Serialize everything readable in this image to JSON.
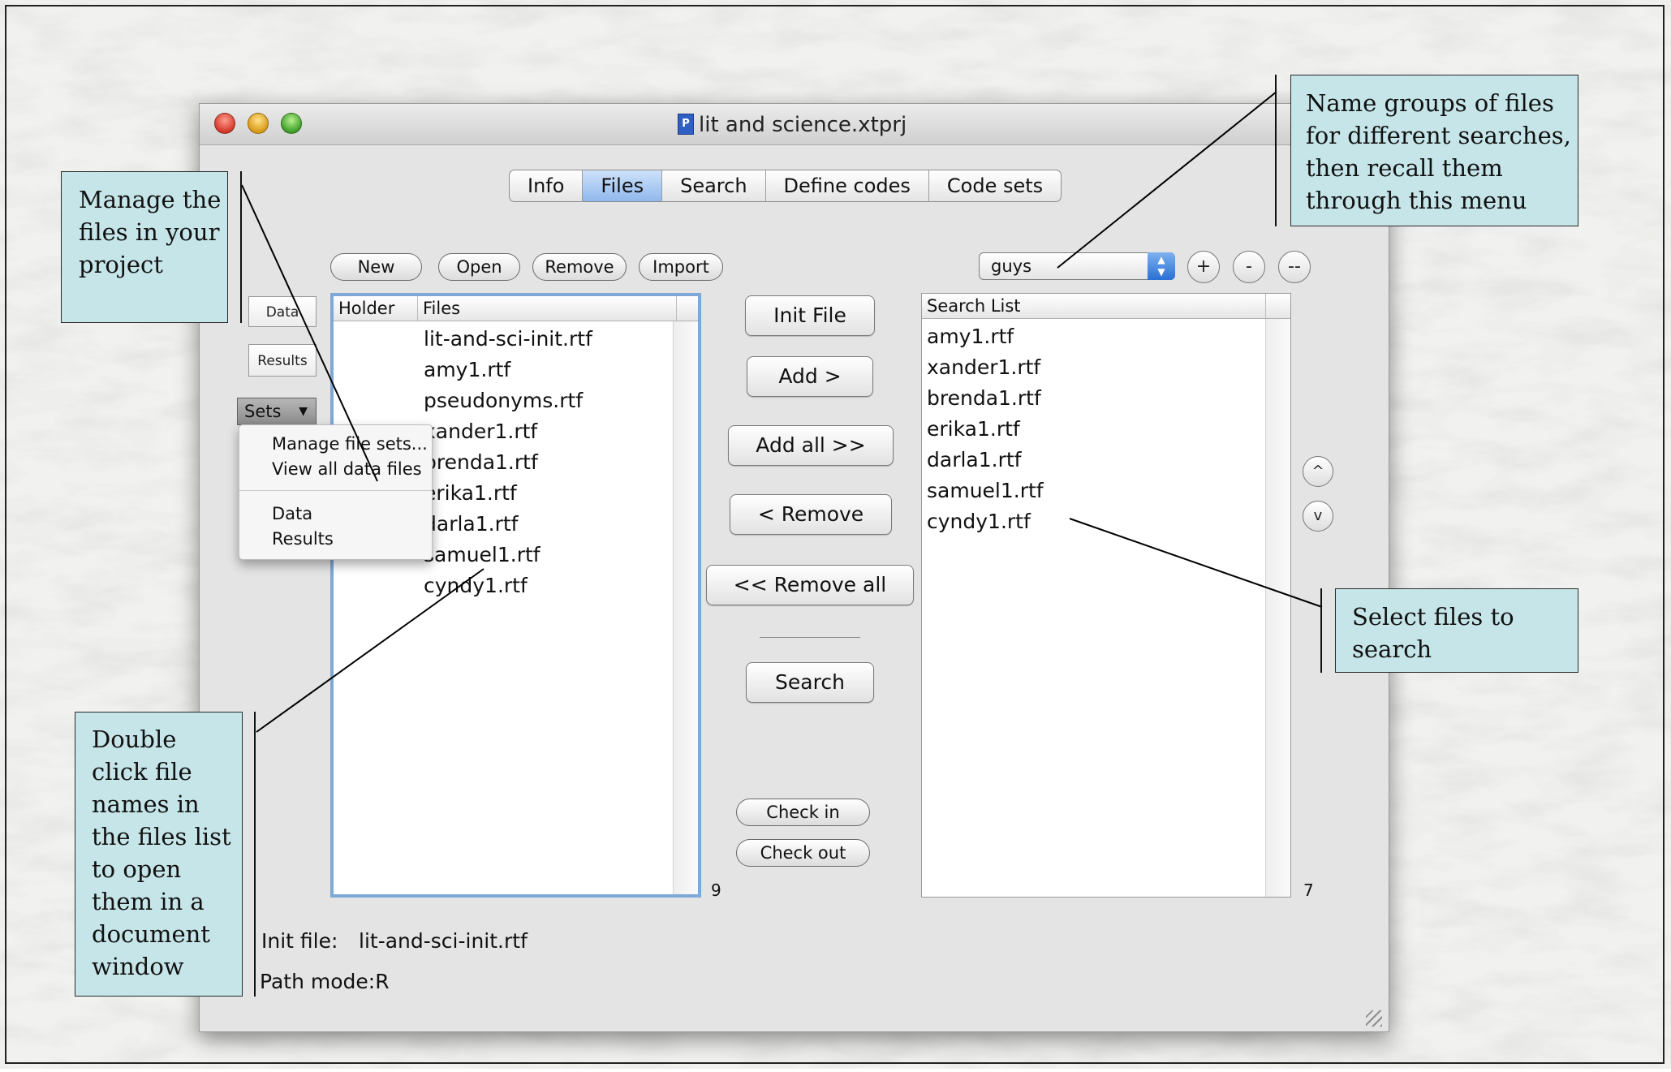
{
  "window": {
    "title": "lit and science.xtprj",
    "doc_icon_glyph": "P"
  },
  "tabs": [
    "Info",
    "Files",
    "Search",
    "Define codes",
    "Code sets"
  ],
  "active_tab": "Files",
  "file_toolbar": {
    "new": "New",
    "open": "Open",
    "remove": "Remove",
    "import": "Import"
  },
  "sidebar": {
    "data_button": "Data",
    "results_button": "Results",
    "sets_popup": "Sets",
    "sets_menu": {
      "items": [
        "Manage file sets...",
        "View all data files"
      ],
      "items2": [
        "Data",
        "Results"
      ]
    }
  },
  "files_list": {
    "headers": {
      "holder": "Holder",
      "files": "Files"
    },
    "rows": [
      "lit-and-sci-init.rtf",
      "amy1.rtf",
      "pseudonyms.rtf",
      "xander1.rtf",
      "brenda1.rtf",
      "erika1.rtf",
      "darla1.rtf",
      "samuel1.rtf",
      "cyndy1.rtf"
    ],
    "count": "9"
  },
  "center_buttons": {
    "init_file": "Init File",
    "add": "Add >",
    "add_all": "Add all >>",
    "remove": "< Remove",
    "remove_all": "<< Remove all",
    "search": "Search",
    "check_in": "Check in",
    "check_out": "Check out"
  },
  "search_list": {
    "header": "Search List",
    "rows": [
      "amy1.rtf",
      "xander1.rtf",
      "brenda1.rtf",
      "erika1.rtf",
      "darla1.rtf",
      "samuel1.rtf",
      "cyndy1.rtf"
    ],
    "count": "7"
  },
  "file_set_dropdown": {
    "value": "guys",
    "add": "+",
    "remove": "-",
    "remove_all": "--"
  },
  "order_buttons": {
    "up": "^",
    "down": "v"
  },
  "status": {
    "init_file_label": "Init file:",
    "init_file_value": "lit-and-sci-init.rtf",
    "path_mode": "Path mode:R"
  },
  "callouts": {
    "manage_files": [
      "Manage the",
      "files in your",
      "project"
    ],
    "name_groups": [
      "Name groups of files",
      "for different searches,",
      "then recall them",
      "through this menu"
    ],
    "select_files": [
      "Select files to",
      "search"
    ],
    "double_click": [
      "Double",
      "click file",
      "names in",
      "the files list",
      "to open",
      "them in a",
      "document",
      "window"
    ]
  },
  "colors": {
    "callout_bg": "#c6e5e8",
    "active_tab": "#8fb8ec",
    "list_focus_border": "#7ea8d6"
  }
}
